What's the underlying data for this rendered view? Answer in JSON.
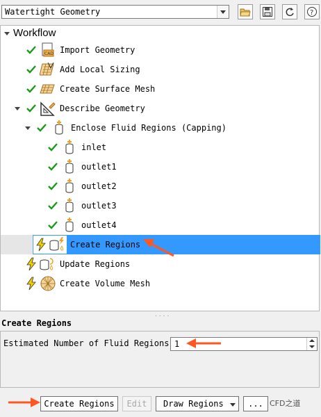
{
  "toolbar": {
    "workflow_select_value": "Watertight Geometry",
    "icons": [
      "open-folder-icon",
      "save-icon",
      "refresh-icon",
      "help-icon"
    ]
  },
  "tree": {
    "root_label": "Workflow",
    "items": [
      {
        "label": "Import Geometry",
        "status": "done"
      },
      {
        "label": "Add Local Sizing",
        "status": "done"
      },
      {
        "label": "Create Surface Mesh",
        "status": "done"
      },
      {
        "label": "Describe Geometry",
        "status": "done"
      },
      {
        "label": "Enclose Fluid Regions (Capping)",
        "status": "done"
      },
      {
        "label": "inlet",
        "status": "done"
      },
      {
        "label": "outlet1",
        "status": "done"
      },
      {
        "label": "outlet2",
        "status": "done"
      },
      {
        "label": "outlet3",
        "status": "done"
      },
      {
        "label": "outlet4",
        "status": "done"
      },
      {
        "label": "Create Regions",
        "status": "pending",
        "selected": true
      },
      {
        "label": "Update Regions",
        "status": "pending"
      },
      {
        "label": "Create Volume Mesh",
        "status": "pending"
      }
    ]
  },
  "panel": {
    "title": "Create Regions",
    "field_label": "Estimated Number of Fluid Regions",
    "field_value": "1"
  },
  "buttons": {
    "create": "Create Regions",
    "edit": "Edit",
    "draw": "Draw Regions",
    "more": "..."
  },
  "watermark": "CFD之道",
  "colors": {
    "selection": "#3399ff",
    "check": "#1a9a1a",
    "lightning": "#f5d000",
    "annotation_arrow": "#ff5722"
  }
}
